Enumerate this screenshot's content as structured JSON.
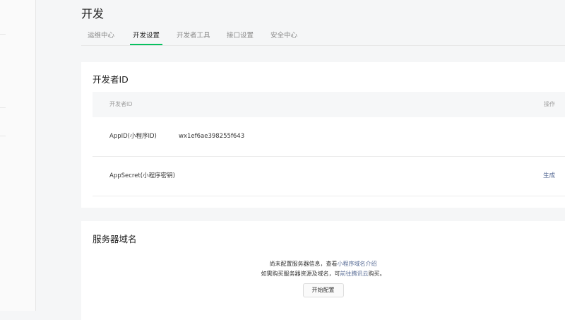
{
  "page": {
    "title": "开发"
  },
  "tabs": [
    {
      "label": "运维中心"
    },
    {
      "label": "开发设置"
    },
    {
      "label": "开发者工具"
    },
    {
      "label": "接口设置"
    },
    {
      "label": "安全中心"
    }
  ],
  "developer_id": {
    "title": "开发者ID",
    "columns": [
      "开发者ID",
      "操作"
    ],
    "rows": [
      {
        "key": "AppID(小程序ID)",
        "value": "wx1ef6ae398255f643",
        "action": ""
      },
      {
        "key": "AppSecret(小程序密钥)",
        "value": "",
        "action": "生成"
      }
    ]
  },
  "server_domain": {
    "title": "服务器域名",
    "line1_text": "尚未配置服务器信息，查看",
    "line1_link": "小程序域名介绍",
    "line2_text": "如需购买服务器资源及域名，可",
    "line2_link": "前往腾讯云",
    "line2_suffix": "购买。",
    "button": "开始配置"
  },
  "colors": {
    "accent": "#07c160",
    "link": "#576b95"
  }
}
